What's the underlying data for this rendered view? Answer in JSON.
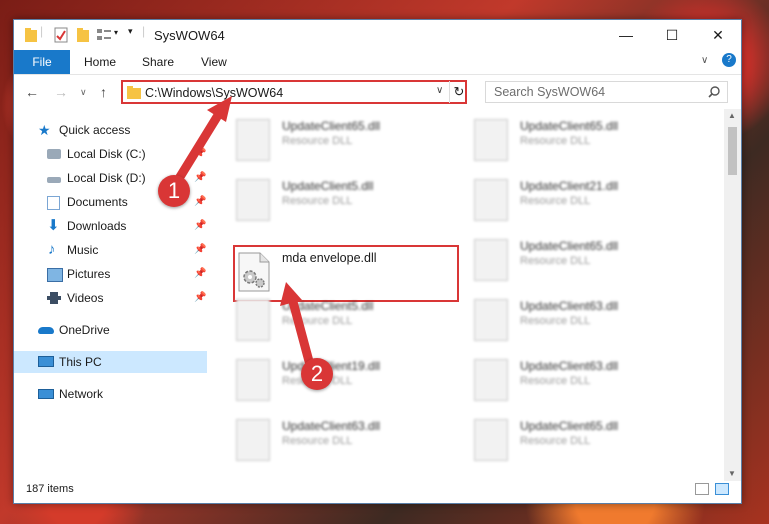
{
  "window": {
    "title": "SysWOW64",
    "controls": {
      "minimize": "—",
      "maximize": "☐",
      "close": "✕"
    }
  },
  "ribbon": {
    "file": "File",
    "tabs": [
      "Home",
      "Share",
      "View"
    ]
  },
  "address": {
    "path": "C:\\Windows\\SysWOW64",
    "search_placeholder": "Search SysWOW64"
  },
  "sidebar": {
    "items": [
      {
        "label": "Quick access",
        "icon": "star-icon"
      },
      {
        "label": "Local Disk (C:)",
        "icon": "drive-icon"
      },
      {
        "label": "Local Disk (D:)",
        "icon": "drive-icon"
      },
      {
        "label": "Documents",
        "icon": "documents-icon"
      },
      {
        "label": "Downloads",
        "icon": "download-icon"
      },
      {
        "label": "Music",
        "icon": "music-icon"
      },
      {
        "label": "Pictures",
        "icon": "pictures-icon"
      },
      {
        "label": "Videos",
        "icon": "videos-icon"
      },
      {
        "label": "OneDrive",
        "icon": "cloud-icon"
      },
      {
        "label": "This PC",
        "icon": "computer-icon"
      },
      {
        "label": "Network",
        "icon": "network-icon"
      }
    ]
  },
  "files": [
    {
      "name": "UpdateClient65.dll",
      "type": "Resource DLL"
    },
    {
      "name": "UpdateClient65.dll",
      "type": "Resource DLL"
    },
    {
      "name": "UpdateClient5.dll",
      "type": "Resource DLL"
    },
    {
      "name": "UpdateClient21.dll",
      "type": "Resource DLL"
    },
    {
      "name": "mda envelope.dll",
      "type": ""
    },
    {
      "name": "UpdateClient65.dll",
      "type": "Resource DLL"
    },
    {
      "name": "UpdateClient5.dll",
      "type": "Resource DLL"
    },
    {
      "name": "UpdateClient63.dll",
      "type": "Resource DLL"
    },
    {
      "name": "UpdateClient19.dll",
      "type": "Resource DLL"
    },
    {
      "name": "UpdateClient63.dll",
      "type": "Resource DLL"
    },
    {
      "name": "UpdateClient63.dll",
      "type": "Resource DLL"
    },
    {
      "name": "UpdateClient65.dll",
      "type": "Resource DLL"
    }
  ],
  "status": {
    "count": "187 items"
  },
  "annotations": {
    "step1": "1",
    "step2": "2"
  },
  "colors": {
    "accent": "#1979ca",
    "highlight": "#d93636"
  }
}
